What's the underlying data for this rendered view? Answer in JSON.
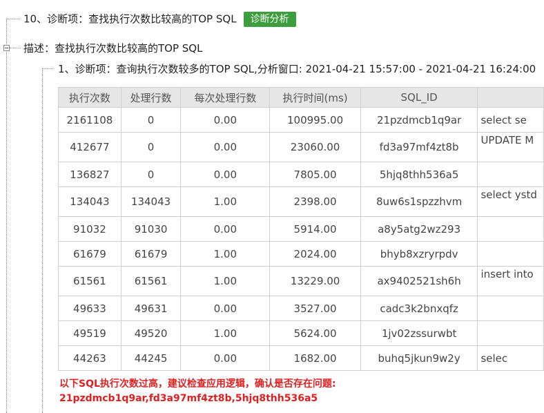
{
  "tree": {
    "item10_title": "10、诊断项：查找执行次数比较高的TOP SQL",
    "item10_badge": "诊断分析",
    "desc_title": "描述：查找执行次数比较高的TOP SQL",
    "sub_title": "1、诊断项：查询执行次数较多的TOP SQL,分析窗口: 2021-04-21 15:57:00 - 2021-04-21 16:24:00"
  },
  "table": {
    "headers": [
      "执行次数",
      "处理行数",
      "每次处理行数",
      "执行时间(ms)",
      "SQL_ID",
      ""
    ],
    "rows": [
      {
        "execs": "2161108",
        "rows": "0",
        "per": "0.00",
        "time": "100995.00",
        "sqlid": "21pzdmcb1q9ar",
        "sql": "select se"
      },
      {
        "execs": "412677",
        "rows": "0",
        "per": "0.00",
        "time": "23060.00",
        "sqlid": "fd3a97mf4zt8b",
        "sql": "UPDATE M"
      },
      {
        "execs": "136827",
        "rows": "0",
        "per": "0.00",
        "time": "7805.00",
        "sqlid": "5hjq8thh536a5",
        "sql": ""
      },
      {
        "execs": "134043",
        "rows": "134043",
        "per": "1.00",
        "time": "2398.00",
        "sqlid": "8uw6s1spzzhvm",
        "sql": "select ystd"
      },
      {
        "execs": "91032",
        "rows": "91030",
        "per": "0.00",
        "time": "5914.00",
        "sqlid": "a8y5atg2wz293",
        "sql": ""
      },
      {
        "execs": "61679",
        "rows": "61679",
        "per": "1.00",
        "time": "2024.00",
        "sqlid": "bhyb8xzryrpdv",
        "sql": ""
      },
      {
        "execs": "61561",
        "rows": "61561",
        "per": "1.00",
        "time": "13229.00",
        "sqlid": "ax9402521sh6h",
        "sql": "insert into"
      },
      {
        "execs": "49633",
        "rows": "49631",
        "per": "0.00",
        "time": "3527.00",
        "sqlid": "cadc3k2bnxqfz",
        "sql": ""
      },
      {
        "execs": "49519",
        "rows": "49520",
        "per": "1.00",
        "time": "5624.00",
        "sqlid": "1jv02zssurwbt",
        "sql": ""
      },
      {
        "execs": "44263",
        "rows": "44245",
        "per": "0.00",
        "time": "1682.00",
        "sqlid": "buhq5jkun9w2y",
        "sql": "selec"
      }
    ]
  },
  "warning": {
    "line1": "以下SQL执行次数过高，建议检查应用逻辑，确认是否存在问题:",
    "line2": "21pzdmcb1q9ar,fd3a97mf4zt8b,5hjq8thh536a5"
  }
}
